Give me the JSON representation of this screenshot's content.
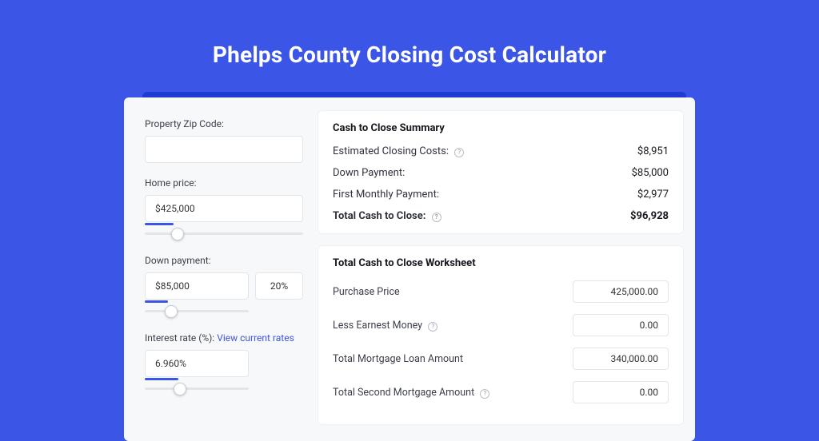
{
  "header": {
    "title": "Phelps County Closing Cost Calculator"
  },
  "form": {
    "zip_label": "Property Zip Code:",
    "zip_value": "",
    "home_price_label": "Home price:",
    "home_price_value": "$425,000",
    "home_price_slider_pct": 18,
    "down_payment_label": "Down payment:",
    "down_payment_value": "$85,000",
    "down_payment_pct": "20%",
    "down_payment_slider_pct": 22,
    "interest_label": "Interest rate (%):",
    "interest_link": "View current rates",
    "interest_value": "6.960%",
    "interest_slider_pct": 32
  },
  "summary": {
    "title": "Cash to Close Summary",
    "rows": [
      {
        "label": "Estimated Closing Costs:",
        "value": "$8,951",
        "help": true
      },
      {
        "label": "Down Payment:",
        "value": "$85,000",
        "help": false
      },
      {
        "label": "First Monthly Payment:",
        "value": "$2,977",
        "help": false
      }
    ],
    "total_label": "Total Cash to Close:",
    "total_value": "$96,928"
  },
  "worksheet": {
    "title": "Total Cash to Close Worksheet",
    "rows": [
      {
        "label": "Purchase Price",
        "value": "425,000.00",
        "help": false
      },
      {
        "label": "Less Earnest Money",
        "value": "0.00",
        "help": true
      },
      {
        "label": "Total Mortgage Loan Amount",
        "value": "340,000.00",
        "help": false
      },
      {
        "label": "Total Second Mortgage Amount",
        "value": "0.00",
        "help": true
      }
    ]
  }
}
